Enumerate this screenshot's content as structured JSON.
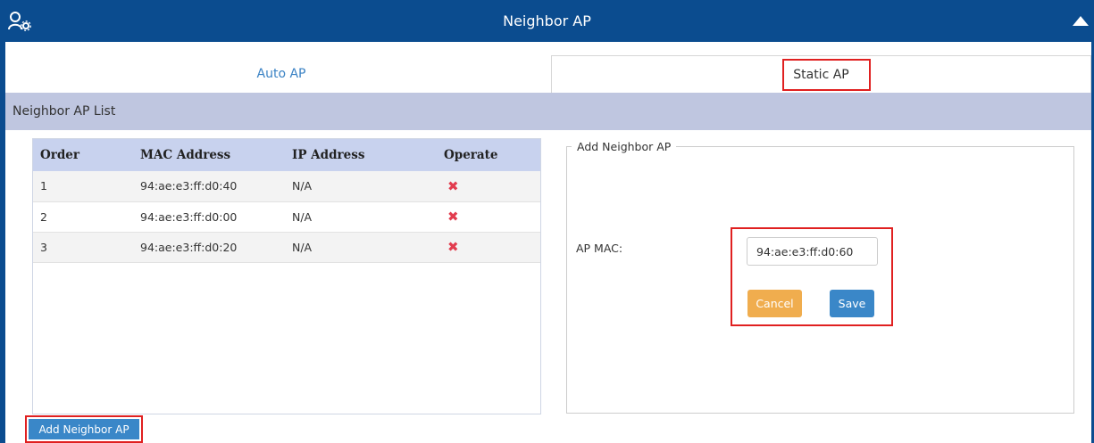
{
  "header": {
    "title": "Neighbor AP",
    "user_icon": "user-settings-icon",
    "collapse_icon": "triangle-up-icon"
  },
  "tabs": [
    {
      "label": "Auto AP",
      "active": false
    },
    {
      "label": "Static AP",
      "active": true
    }
  ],
  "section": {
    "title": "Neighbor AP List"
  },
  "table": {
    "columns": [
      "Order",
      "MAC Address",
      "IP Address",
      "Operate"
    ],
    "rows": [
      {
        "order": "1",
        "mac": "94:ae:e3:ff:d0:40",
        "ip": "N/A",
        "operate_icon": "delete-x-icon"
      },
      {
        "order": "2",
        "mac": "94:ae:e3:ff:d0:00",
        "ip": "N/A",
        "operate_icon": "delete-x-icon"
      },
      {
        "order": "3",
        "mac": "94:ae:e3:ff:d0:20",
        "ip": "N/A",
        "operate_icon": "delete-x-icon"
      }
    ]
  },
  "add_button": {
    "label": "Add Neighbor AP"
  },
  "form": {
    "legend": "Add Neighbor AP",
    "ap_mac_label": "AP MAC:",
    "ap_mac_value": "94:ae:e3:ff:d0:60",
    "cancel_label": "Cancel",
    "save_label": "Save"
  },
  "colors": {
    "header_bg": "#0b4c8f",
    "section_bg": "#bfc6e0",
    "table_header_bg": "#c8d2ee",
    "primary_button": "#3a87c8",
    "cancel_button": "#f0ad4e",
    "delete_icon": "#e23c4e",
    "highlight": "#e02020"
  }
}
